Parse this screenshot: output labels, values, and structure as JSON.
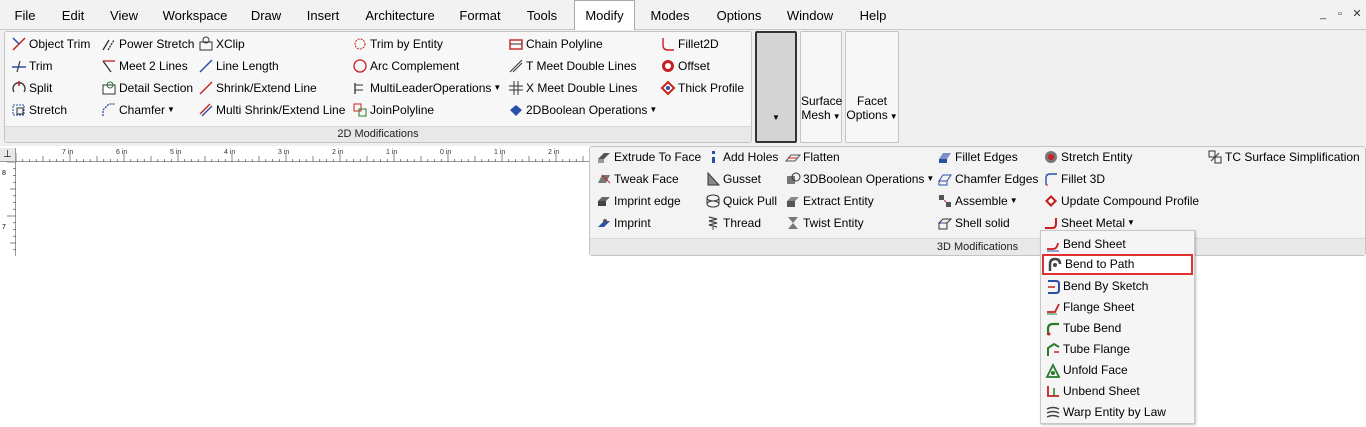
{
  "menubar": {
    "items": [
      "File",
      "Edit",
      "View",
      "Workspace",
      "Draw",
      "Insert",
      "Architecture",
      "Format",
      "Tools",
      "Modify",
      "Modes",
      "Options",
      "Window",
      "Help"
    ],
    "active": "Modify",
    "window_controls": [
      "_",
      "▫",
      "✕"
    ]
  },
  "panel_2d": {
    "title": "2D Modifications",
    "tools": [
      {
        "label": "Object Trim",
        "icon": "object-trim-icon"
      },
      {
        "label": "Trim",
        "icon": "trim-icon"
      },
      {
        "label": "Split",
        "icon": "split-icon"
      },
      {
        "label": "Stretch",
        "icon": "stretch-icon"
      },
      {
        "label": "Power Stretch",
        "icon": "power-stretch-icon"
      },
      {
        "label": "Meet 2 Lines",
        "icon": "meet-2-lines-icon"
      },
      {
        "label": "Detail Section",
        "icon": "detail-section-icon"
      },
      {
        "label": "Chamfer",
        "icon": "chamfer-icon",
        "dropdown": true
      },
      {
        "label": "XClip",
        "icon": "xclip-icon"
      },
      {
        "label": "Line Length",
        "icon": "line-length-icon"
      },
      {
        "label": "Shrink/Extend Line",
        "icon": "shrink-extend-line-icon"
      },
      {
        "label": "Multi Shrink/Extend Line",
        "icon": "multi-shrink-extend-line-icon"
      },
      {
        "label": "Trim by Entity",
        "icon": "trim-by-entity-icon"
      },
      {
        "label": "Arc Complement",
        "icon": "arc-complement-icon"
      },
      {
        "label": "MultiLeaderOperations",
        "icon": "multileader-operations-icon",
        "dropdown": true
      },
      {
        "label": "JoinPolyline",
        "icon": "join-polyline-icon"
      },
      {
        "label": "Chain Polyline",
        "icon": "chain-polyline-icon"
      },
      {
        "label": "T Meet Double Lines",
        "icon": "t-meet-double-lines-icon"
      },
      {
        "label": "X Meet Double Lines",
        "icon": "x-meet-double-lines-icon"
      },
      {
        "label": "2DBoolean Operations",
        "icon": "2d-boolean-operations-icon",
        "dropdown": true
      },
      {
        "label": "Fillet2D",
        "icon": "fillet2d-icon"
      },
      {
        "label": "Offset",
        "icon": "offset-icon"
      },
      {
        "label": "Thick Profile",
        "icon": "thick-profile-icon"
      }
    ]
  },
  "surface_mesh": {
    "line1": "Surface",
    "line2": "Mesh"
  },
  "facet_options": {
    "line1": "Facet",
    "line2": "Options"
  },
  "panel_3d": {
    "title": "3D Modifications",
    "tools": [
      {
        "label": "Extrude To Face",
        "icon": "extrude-to-face-icon"
      },
      {
        "label": "Tweak Face",
        "icon": "tweak-face-icon"
      },
      {
        "label": "Imprint edge",
        "icon": "imprint-edge-icon"
      },
      {
        "label": "Imprint",
        "icon": "imprint-icon"
      },
      {
        "label": "Add Holes",
        "icon": "add-holes-icon"
      },
      {
        "label": "Gusset",
        "icon": "gusset-icon"
      },
      {
        "label": "Quick Pull",
        "icon": "quick-pull-icon"
      },
      {
        "label": "Thread",
        "icon": "thread-icon"
      },
      {
        "label": "Flatten",
        "icon": "flatten-icon"
      },
      {
        "label": "3DBoolean Operations",
        "icon": "3d-boolean-operations-icon",
        "dropdown": true
      },
      {
        "label": "Extract Entity",
        "icon": "extract-entity-icon"
      },
      {
        "label": "Twist Entity",
        "icon": "twist-entity-icon"
      },
      {
        "label": "Fillet Edges",
        "icon": "fillet-edges-icon"
      },
      {
        "label": "Chamfer Edges",
        "icon": "chamfer-edges-icon"
      },
      {
        "label": "Assemble",
        "icon": "assemble-icon",
        "dropdown": true
      },
      {
        "label": "Shell solid",
        "icon": "shell-solid-icon"
      },
      {
        "label": "Stretch Entity",
        "icon": "stretch-entity-icon"
      },
      {
        "label": "Fillet 3D",
        "icon": "fillet-3d-icon"
      },
      {
        "label": "Update Compound Profile",
        "icon": "update-compound-profile-icon"
      },
      {
        "label": "Sheet Metal",
        "icon": "sheet-metal-icon",
        "dropdown": true
      },
      {
        "label": "TC Surface Simplification",
        "icon": "tc-surface-simplification-icon"
      }
    ]
  },
  "ruler": {
    "labels": [
      "7 in",
      "6 in",
      "5 in",
      "4 in",
      "3 in",
      "2 in",
      "1 in",
      "0 in",
      "1 in",
      "2 in"
    ],
    "v_labels": [
      "8",
      "7"
    ]
  },
  "sheet_metal_menu": {
    "items": [
      {
        "label": "Bend Sheet",
        "icon": "bend-sheet-icon"
      },
      {
        "label": "Bend to Path",
        "icon": "bend-to-path-icon"
      },
      {
        "label": "Bend By Sketch",
        "icon": "bend-by-sketch-icon"
      },
      {
        "label": "Flange Sheet",
        "icon": "flange-sheet-icon"
      },
      {
        "label": "Tube Bend",
        "icon": "tube-bend-icon"
      },
      {
        "label": "Tube Flange",
        "icon": "tube-flange-icon"
      },
      {
        "label": "Unfold Face",
        "icon": "unfold-face-icon"
      },
      {
        "label": "Unbend Sheet",
        "icon": "unbend-sheet-icon"
      },
      {
        "label": "Warp Entity by Law",
        "icon": "warp-entity-by-law-icon"
      }
    ],
    "highlighted": "Bend to Path"
  },
  "colors": {
    "accent_red": "#e03030",
    "icon_blue": "#2a4fa8",
    "icon_red": "#c62020"
  }
}
